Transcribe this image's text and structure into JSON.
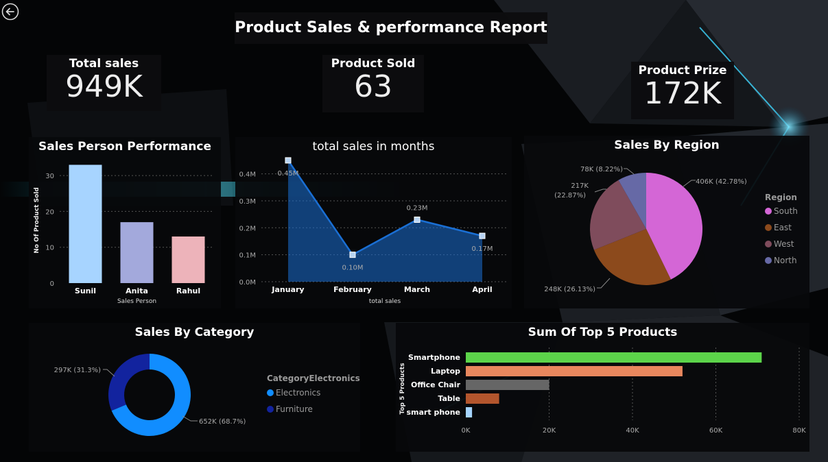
{
  "header": {
    "title": "Product Sales & performance Report"
  },
  "kpis": [
    {
      "label": "Total sales",
      "value": "949K"
    },
    {
      "label": "Product Sold",
      "value": "63"
    },
    {
      "label": "Product Prize",
      "value": "172K"
    }
  ],
  "colors": {
    "accent": "#1a8cff",
    "bg": "#050607"
  },
  "chart_data": [
    {
      "type": "bar",
      "title": "Sales Person Performance",
      "categories": [
        "Sunil",
        "Anita",
        "Rahul"
      ],
      "values": [
        33,
        17,
        13
      ],
      "colors": [
        "#a7d4ff",
        "#a3a9dc",
        "#edb3ba"
      ],
      "xlabel": "Sales Person",
      "ylabel": "No Of Product Sold",
      "ylim": [
        0,
        35
      ],
      "yticks": [
        "0",
        "10",
        "20",
        "30"
      ],
      "grid": true
    },
    {
      "type": "area",
      "title": "total sales in months",
      "categories": [
        "January",
        "February",
        "March",
        "April"
      ],
      "values": [
        0.45,
        0.1,
        0.23,
        0.17
      ],
      "labels": [
        "0.45M",
        "0.10M",
        "0.23M",
        "0.17M"
      ],
      "xlabel": "total sales",
      "ylabel": "",
      "ylim": [
        0,
        0.46
      ],
      "yticks": [
        "0.0M",
        "0.1M",
        "0.2M",
        "0.3M",
        "0.4M"
      ],
      "color": "#1a6fd4",
      "grid": true
    },
    {
      "type": "pie",
      "title": "Sales By Region",
      "legend_title": "Region",
      "legend_position": "right",
      "slices": [
        {
          "name": "South",
          "value": 406,
          "label": "406K (42.78%)",
          "color": "#d466d6"
        },
        {
          "name": "East",
          "value": 248,
          "label": "248K (26.13%)",
          "color": "#8c4a1c"
        },
        {
          "name": "West",
          "value": 217,
          "label_line1": "217K",
          "label_line2": "(22.87%)",
          "color": "#7f4c5c"
        },
        {
          "name": "North",
          "value": 78,
          "label": "78K (8.22%)",
          "color": "#6669a6"
        }
      ]
    },
    {
      "type": "pie",
      "donut": true,
      "title": "Sales By Category",
      "legend_title": "CategoryElectronics",
      "legend_position": "right",
      "slices": [
        {
          "name": "Electronics",
          "value": 652,
          "label": "652K (68.7%)",
          "color": "#118dff"
        },
        {
          "name": "Furniture",
          "value": 297,
          "label": "297K (31.3%)",
          "color": "#12239e"
        }
      ]
    },
    {
      "type": "bar",
      "orientation": "horizontal",
      "title": "Sum Of Top 5 Products",
      "categories": [
        "Smartphone",
        "Laptop",
        "Office Chair",
        "Table",
        "smart phone"
      ],
      "values": [
        71000,
        52000,
        20000,
        8000,
        1500
      ],
      "colors": [
        "#5cd44a",
        "#e8875e",
        "#666666",
        "#b3552d",
        "#a5d4ff"
      ],
      "ylabel": "Top 5 Products",
      "xlim": [
        0,
        80000
      ],
      "xticks": [
        "0K",
        "20K",
        "40K",
        "60K",
        "80K"
      ],
      "grid": true
    }
  ]
}
